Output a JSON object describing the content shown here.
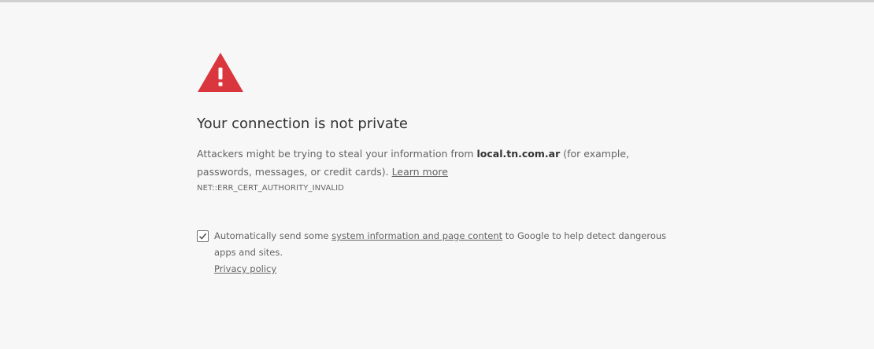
{
  "icon": "red-triangle-warning-icon",
  "accent_color": "#db4437",
  "heading": "Your connection is not private",
  "explanation": {
    "prefix": "Attackers might be trying to steal your information from ",
    "host": "local.tn.com.ar",
    "suffix": " (for example, passwords, messages, or credit cards). ",
    "learn_more": "Learn more"
  },
  "error_code": "NET::ERR_CERT_AUTHORITY_INVALID",
  "extended_reporting": {
    "checked": true,
    "prefix": "Automatically send some ",
    "link": "system information and page content",
    "suffix": " to Google to help detect dangerous apps and sites.",
    "privacy_policy": "Privacy policy"
  }
}
